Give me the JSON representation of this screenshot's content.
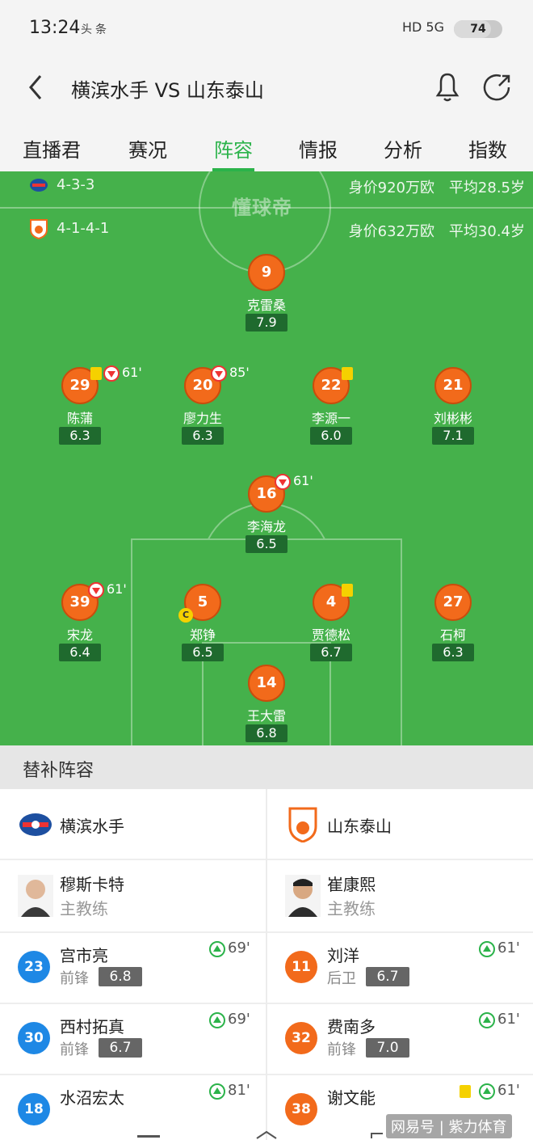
{
  "status": {
    "time": "13:24",
    "left_icons": "头条",
    "network": "HD 5G",
    "battery": "74"
  },
  "header": {
    "title": "横滨水手 VS 山东泰山"
  },
  "tabs": [
    {
      "label": "直播君"
    },
    {
      "label": "赛况"
    },
    {
      "label": "阵容"
    },
    {
      "label": "情报"
    },
    {
      "label": "分析"
    },
    {
      "label": "指数"
    }
  ],
  "pitch": {
    "watermark": "懂球帝",
    "home": {
      "formation": "4-3-3",
      "value": "身价920万欧",
      "avg_age": "平均28.5岁"
    },
    "away": {
      "formation": "4-1-4-1",
      "value": "身价632万欧",
      "avg_age": "平均30.4岁"
    },
    "players": [
      {
        "number": "9",
        "name": "克雷桑",
        "rating": "7.9"
      },
      {
        "number": "29",
        "name": "陈蒲",
        "rating": "6.3",
        "sub_time": "61'"
      },
      {
        "number": "20",
        "name": "廖力生",
        "rating": "6.3",
        "sub_time": "85'"
      },
      {
        "number": "22",
        "name": "李源一",
        "rating": "6.0"
      },
      {
        "number": "21",
        "name": "刘彬彬",
        "rating": "7.1"
      },
      {
        "number": "16",
        "name": "李海龙",
        "rating": "6.5",
        "sub_time": "61'"
      },
      {
        "number": "39",
        "name": "宋龙",
        "rating": "6.4",
        "sub_time": "61'"
      },
      {
        "number": "5",
        "name": "郑铮",
        "rating": "6.5",
        "captain": "C"
      },
      {
        "number": "4",
        "name": "贾德松",
        "rating": "6.7"
      },
      {
        "number": "27",
        "name": "石柯",
        "rating": "6.3"
      },
      {
        "number": "14",
        "name": "王大雷",
        "rating": "6.8"
      }
    ]
  },
  "subs": {
    "heading": "替补阵容",
    "home": {
      "team": "横滨水手",
      "coach": {
        "name": "穆斯卡特",
        "role": "主教练"
      },
      "players": [
        {
          "number": "23",
          "name": "宫市亮",
          "pos": "前锋",
          "rating": "6.8",
          "time": "69'"
        },
        {
          "number": "30",
          "name": "西村拓真",
          "pos": "前锋",
          "rating": "6.7",
          "time": "69'"
        },
        {
          "number": "18",
          "name": "水沼宏太",
          "pos": "",
          "rating": "",
          "time": "81'"
        }
      ]
    },
    "away": {
      "team": "山东泰山",
      "coach": {
        "name": "崔康熙",
        "role": "主教练"
      },
      "players": [
        {
          "number": "11",
          "name": "刘洋",
          "pos": "后卫",
          "rating": "6.7",
          "time": "61'"
        },
        {
          "number": "32",
          "name": "费南多",
          "pos": "前锋",
          "rating": "7.0",
          "time": "61'"
        },
        {
          "number": "38",
          "name": "谢文能",
          "pos": "",
          "rating": "",
          "time": "61'"
        }
      ]
    }
  },
  "footer_watermark": "网易号 | 紫力体育",
  "colors": {
    "accent": "#2bb34a",
    "pitch": "#45b14b",
    "player": "#f26a1b",
    "home_sub": "#1e88e5",
    "away_sub": "#f26a1b"
  }
}
